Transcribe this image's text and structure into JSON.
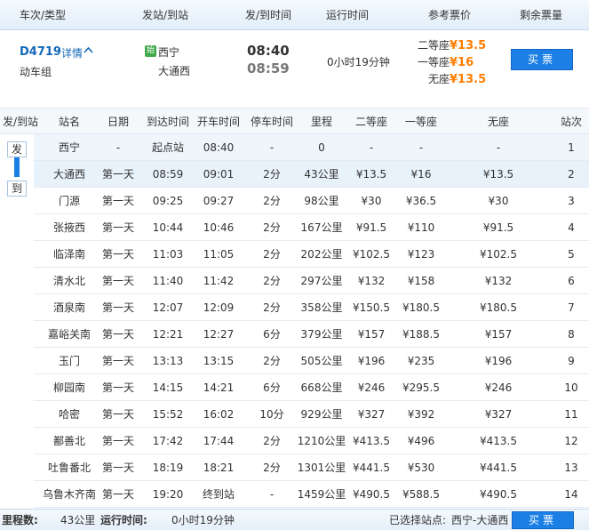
{
  "header": {
    "train_type": "车次/类型",
    "stations": "发站/到站",
    "times": "发/到时间",
    "duration": "运行时间",
    "price": "参考票价",
    "remaining": "剩余票量"
  },
  "train": {
    "code": "D4719",
    "detail_link": "详情",
    "chevron": "^",
    "type": "动车组",
    "origin_badge": "始",
    "from": "西宁",
    "to": "大通西",
    "depart": "08:40",
    "arrive": "08:59",
    "duration": "0小时19分钟",
    "prices": [
      {
        "seat": "二等座",
        "value": "¥13.5"
      },
      {
        "seat": "一等座",
        "value": "¥16"
      },
      {
        "seat": "无座",
        "value": "¥13.5"
      }
    ],
    "buy_label": "买票"
  },
  "stops_header": [
    "发/到站",
    "站名",
    "日期",
    "到达时间",
    "开车时间",
    "停车时间",
    "里程",
    "二等座",
    "一等座",
    "无座",
    "站次"
  ],
  "markers": {
    "depart": "发",
    "arrive": "到"
  },
  "stops": [
    [
      "西宁",
      "-",
      "起点站",
      "08:40",
      "-",
      "0",
      "-",
      "-",
      "-",
      "1"
    ],
    [
      "大通西",
      "第一天",
      "08:59",
      "09:01",
      "2分",
      "43公里",
      "¥13.5",
      "¥16",
      "¥13.5",
      "2"
    ],
    [
      "门源",
      "第一天",
      "09:25",
      "09:27",
      "2分",
      "98公里",
      "¥30",
      "¥36.5",
      "¥30",
      "3"
    ],
    [
      "张掖西",
      "第一天",
      "10:44",
      "10:46",
      "2分",
      "167公里",
      "¥91.5",
      "¥110",
      "¥91.5",
      "4"
    ],
    [
      "临泽南",
      "第一天",
      "11:03",
      "11:05",
      "2分",
      "202公里",
      "¥102.5",
      "¥123",
      "¥102.5",
      "5"
    ],
    [
      "清水北",
      "第一天",
      "11:40",
      "11:42",
      "2分",
      "297公里",
      "¥132",
      "¥158",
      "¥132",
      "6"
    ],
    [
      "酒泉南",
      "第一天",
      "12:07",
      "12:09",
      "2分",
      "358公里",
      "¥150.5",
      "¥180.5",
      "¥180.5",
      "7"
    ],
    [
      "嘉峪关南",
      "第一天",
      "12:21",
      "12:27",
      "6分",
      "379公里",
      "¥157",
      "¥188.5",
      "¥157",
      "8"
    ],
    [
      "玉门",
      "第一天",
      "13:13",
      "13:15",
      "2分",
      "505公里",
      "¥196",
      "¥235",
      "¥196",
      "9"
    ],
    [
      "柳园南",
      "第一天",
      "14:15",
      "14:21",
      "6分",
      "668公里",
      "¥246",
      "¥295.5",
      "¥246",
      "10"
    ],
    [
      "哈密",
      "第一天",
      "15:52",
      "16:02",
      "10分",
      "929公里",
      "¥327",
      "¥392",
      "¥327",
      "11"
    ],
    [
      "鄯善北",
      "第一天",
      "17:42",
      "17:44",
      "2分",
      "1210公里",
      "¥413.5",
      "¥496",
      "¥413.5",
      "12"
    ],
    [
      "吐鲁番北",
      "第一天",
      "18:19",
      "18:21",
      "2分",
      "1301公里",
      "¥441.5",
      "¥530",
      "¥441.5",
      "13"
    ],
    [
      "乌鲁木齐南",
      "第一天",
      "19:20",
      "终到站",
      "-",
      "1459公里",
      "¥490.5",
      "¥588.5",
      "¥490.5",
      "14"
    ]
  ],
  "footer": {
    "mileage_label": "里程数:",
    "mileage_value": "43公里",
    "runtime_label": "运行时间:",
    "runtime_value": "0小时19分钟",
    "selected_label": "已选择站点:",
    "selected_value": "西宁-大通西",
    "buy_label": "买票"
  },
  "colors": {
    "accent": "#1b7fe6",
    "price": "#ff7e00",
    "link": "#1468b8"
  }
}
